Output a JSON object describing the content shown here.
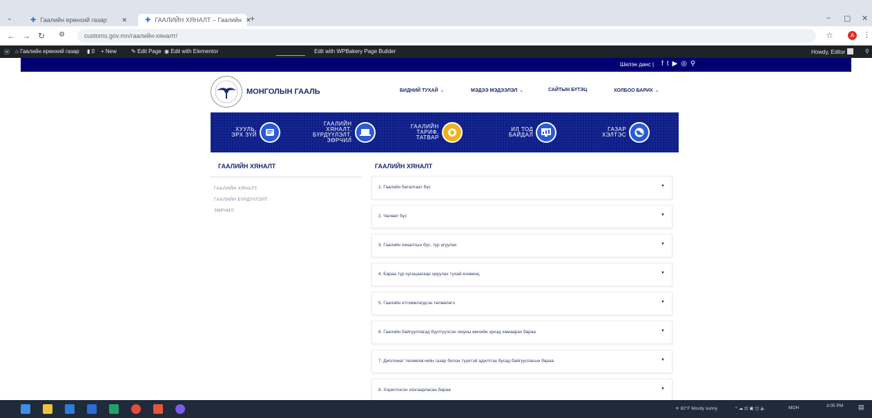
{
  "browser": {
    "tabs": [
      {
        "label": "Гаалийн ерөнхий газар",
        "active": false
      },
      {
        "label": "ГААЛИЙН ХЯНАЛТ – Гаалийн",
        "active": true
      }
    ],
    "new_tab": "+",
    "url": "customs.gov.mn/гаалийн-хяналт/",
    "profile_initial": "A",
    "window_controls": [
      "–",
      "▢",
      "✕"
    ]
  },
  "adminbar": {
    "site_name": "Гаалийн ерөнхий газар",
    "comments": "0",
    "new": "New",
    "edit_page": "Edit Page",
    "edit_with": "Edit with Elementor",
    "wpbakery": "Edit with WPBakery Page Builder",
    "howdy": "Howdy, Editor"
  },
  "topstrip": {
    "lang": "Шилэн данс",
    "icons": [
      "facebook-icon",
      "twitter-icon",
      "youtube-icon",
      "instagram-icon",
      "search-icon"
    ]
  },
  "site": {
    "logo_text": "МОНГОЛЫН ГААЛЬ",
    "nav": [
      "БИДНИЙ ТУХАЙ",
      "МЭДЭЭ МЭДЭЭЛЭЛ",
      "САЙТЫН БҮТЭЦ",
      "ХОЛБОО БАРИХ"
    ]
  },
  "quick_links": [
    {
      "lines": [
        "ХУУЛЬ,",
        "ЭРХ ЗҮЙ"
      ],
      "icon": "law-icon"
    },
    {
      "lines": [
        "ГААЛИЙН",
        "ХЯНАЛТ,",
        "БҮРДҮҮЛЭЛТ,",
        "ЗӨРЧИЛ"
      ],
      "icon": "laptop-icon"
    },
    {
      "lines": [
        "ГААЛИЙН",
        "ТАРИФ,",
        "ТАТВАР"
      ],
      "icon": "coins-icon"
    },
    {
      "lines": [
        "ИЛ ТОД",
        "БАЙДАЛ"
      ],
      "icon": "monitor-icon"
    },
    {
      "lines": [
        "ГАЗАР",
        "ХЭЛТЭС"
      ],
      "icon": "globe-icon"
    }
  ],
  "sidebar": {
    "title": "ГААЛИЙН ХЯНАЛТ",
    "links": [
      "ГААЛИЙН ХЯНАЛТ",
      "ГААЛИЙН БҮРДҮҮЛЭЛТ",
      "ЗӨРЧИЛ"
    ]
  },
  "main": {
    "title": "ГААЛИЙН ХЯНАЛТ",
    "items": [
      "1. Гаалийн баталгаат бүс",
      "2. Чөлөөт бүс",
      "3. Гаалийн хяналтын бүс, түр агуулах",
      "4. Бараа түр хугацаагаар оруулах тухай конвенц",
      "5. Гаалийн итгэмжлэгдсэн төлөөлөгч",
      "6. Гаалийн байгууллагад бүртгүүлсэн оюуны өмчийн эрхэд хамаарах бараа",
      "7. Дипломат төлөөлөгчийн газар болон түүнтэй адилтгах бусад байгууллагын бараа",
      "8. Хориглосон хязгаарласан бараа"
    ]
  },
  "taskbar": {
    "weather": "82°F Mostly sunny",
    "lang": "МОН",
    "time": "3:05 PM"
  }
}
